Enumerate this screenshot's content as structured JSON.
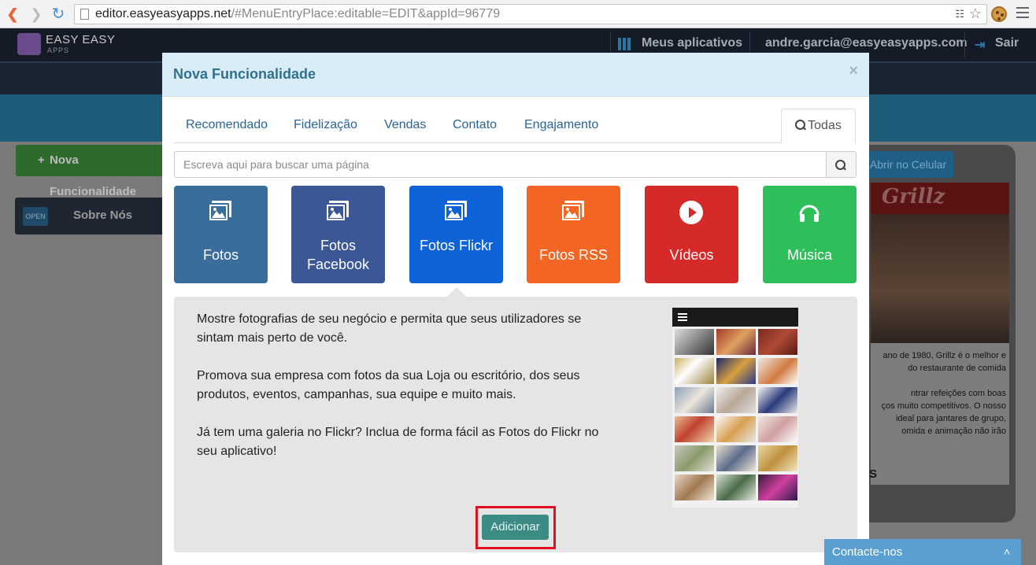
{
  "browser": {
    "url_main": "editor.easyeasyapps.net",
    "url_rest": "/#MenuEntryPlace:editable=EDIT&appId=96779"
  },
  "app": {
    "logo_text": "EASY EASY",
    "logo_sub": "APPS",
    "my_apps": "Meus aplicativos",
    "user_email": "andre.garcia@easyeasyapps.com",
    "logout": "Sair",
    "new_feature_button": "Nova Funcionalidade",
    "menu_item_open_sign": "OPEN",
    "menu_item_label": "Sobre Nós",
    "open_on_phone": "Abrir no Celular",
    "phone_brand": "Grillz",
    "phone_text": "ano de 1980, Grillz é o melhor e\ndo restaurante de comida\n\nntrar refeições com boas\nços muito competitivos. O nosso\n ideal para jantares de grupo,\nomida e animação não irão",
    "phone_letters": "S"
  },
  "modal": {
    "title": "Nova Funcionalidade",
    "close": "×",
    "tabs": [
      "Recomendado",
      "Fidelização",
      "Vendas",
      "Contato",
      "Engajamento"
    ],
    "active_tab": "Todas",
    "search_placeholder": "Escreva aqui para buscar uma página",
    "tiles": [
      {
        "label": "Fotos",
        "color": "#3a6d9a",
        "icon": "image-icon"
      },
      {
        "label": "Fotos Facebook",
        "color": "#3b5796",
        "icon": "image-icon"
      },
      {
        "label": "Fotos Flickr",
        "color": "#0e63d9",
        "icon": "image-icon"
      },
      {
        "label": "Fotos RSS",
        "color": "#f26522",
        "icon": "image-icon"
      },
      {
        "label": "Vídeos",
        "color": "#d62a2a",
        "icon": "play-icon"
      },
      {
        "label": "Música",
        "color": "#2fbf5a",
        "icon": "headphones-icon"
      }
    ],
    "description": [
      "Mostre fotografias de seu negócio e permita que seus utilizadores se sintam mais perto de você.",
      "Promova sua empresa com fotos da sua Loja ou escritório, dos seus produtos, eventos, campanhas, sua equipe e muito mais.",
      "Já tem uma galeria no Flickr? Inclua de forma fácil as Fotos do Flickr no seu aplicativo!"
    ],
    "add_button": "Adicionar"
  },
  "contact": {
    "label": "Contacte-nos"
  }
}
